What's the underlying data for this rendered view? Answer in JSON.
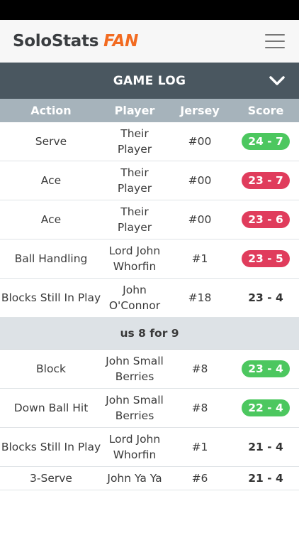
{
  "app": {
    "brand_main": "SoloStats",
    "brand_accent": "FAN"
  },
  "section": {
    "title": "GAME LOG"
  },
  "columns": {
    "action": "Action",
    "player": "Player",
    "jersey": "Jersey",
    "score": "Score"
  },
  "rows": [
    {
      "action": "Serve",
      "player": "Their Player",
      "jersey": "#00",
      "score": "24 - 7",
      "score_style": "green"
    },
    {
      "action": "Ace",
      "player": "Their Player",
      "jersey": "#00",
      "score": "23 - 7",
      "score_style": "red"
    },
    {
      "action": "Ace",
      "player": "Their Player",
      "jersey": "#00",
      "score": "23 - 6",
      "score_style": "red"
    },
    {
      "action": "Ball Handling",
      "player": "Lord John Whorfin",
      "jersey": "#1",
      "score": "23 - 5",
      "score_style": "red"
    },
    {
      "action": "Blocks Still In Play",
      "player": "John O'Connor",
      "jersey": "#18",
      "score": "23 - 4",
      "score_style": "plain"
    }
  ],
  "set_summary": "us 8 for 9",
  "rows_after": [
    {
      "action": "Block",
      "player": "John Small Berries",
      "jersey": "#8",
      "score": "23 - 4",
      "score_style": "green"
    },
    {
      "action": "Down Ball Hit",
      "player": "John Small Berries",
      "jersey": "#8",
      "score": "22 - 4",
      "score_style": "green"
    },
    {
      "action": "Blocks Still In Play",
      "player": "Lord John Whorfin",
      "jersey": "#1",
      "score": "21 - 4",
      "score_style": "plain"
    },
    {
      "action": "3-Serve",
      "player": "John Ya Ya",
      "jersey": "#6",
      "score": "21 - 4",
      "score_style": "plain"
    }
  ],
  "colors": {
    "green": "#4cc75f",
    "red": "#e03c5c",
    "brand_accent": "#f26b21",
    "header_bar": "#4a5760",
    "column_bar": "#a6b3bb"
  }
}
